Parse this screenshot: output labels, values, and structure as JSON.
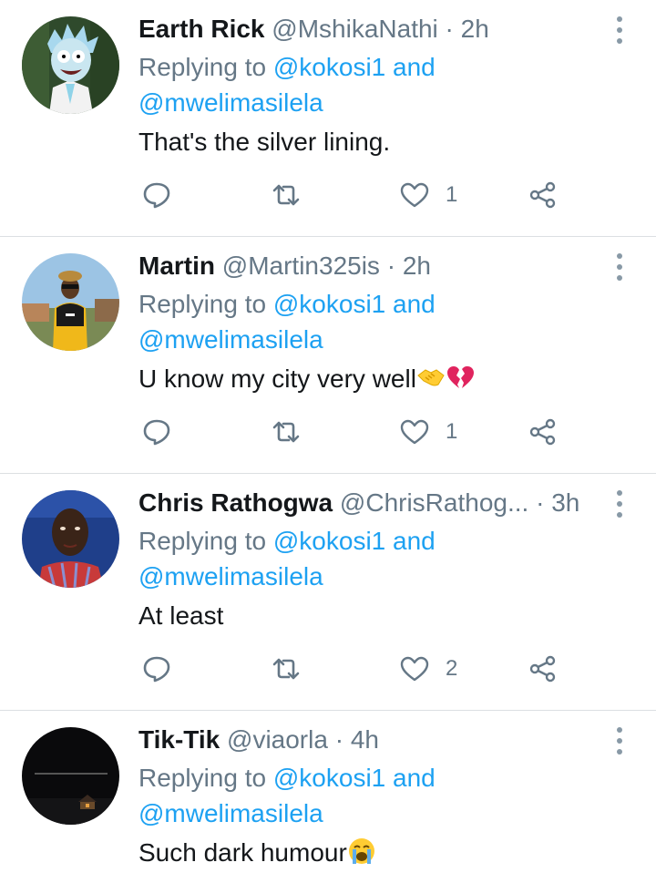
{
  "tweets": [
    {
      "name": "Earth Rick",
      "handle": "@MshikaNathi",
      "time": "2h",
      "replying_prefix": "Replying to",
      "mention1": "@kokosi1",
      "and": "and",
      "mention2": "@mwelimasilela",
      "text": "That's the silver lining.",
      "emojis": [],
      "likes": "1",
      "avatar": "rick-cartoon-avatar"
    },
    {
      "name": "Martin",
      "handle": "@Martin325is",
      "time": "2h",
      "replying_prefix": "Replying to",
      "mention1": "@kokosi1",
      "and": "and",
      "mention2": "@mwelimasilela",
      "text": "U know my city very well",
      "emojis": [
        "handshake",
        "broken-heart"
      ],
      "likes": "1",
      "avatar": "man-yellow-hoodie-avatar"
    },
    {
      "name": "Chris Rathogwa",
      "handle": "@ChrisRathog...",
      "time": "3h",
      "replying_prefix": "Replying to",
      "mention1": "@kokosi1",
      "and": "and",
      "mention2": "@mwelimasilela",
      "text": "At least",
      "emojis": [],
      "likes": "2",
      "avatar": "man-portrait-avatar"
    },
    {
      "name": "Tik-Tik",
      "handle": "@viaorla",
      "time": "4h",
      "replying_prefix": "Replying to",
      "mention1": "@kokosi1",
      "and": "and",
      "mention2": "@mwelimasilela",
      "text": "Such dark humour",
      "emojis": [
        "loudly-crying-face"
      ],
      "likes": "",
      "avatar": "night-house-avatar"
    }
  ],
  "colors": {
    "primary_text": "#14171a",
    "secondary_text": "#657786",
    "link": "#1da1f2",
    "icon": "#657786",
    "divider": "#dcdfe2"
  }
}
